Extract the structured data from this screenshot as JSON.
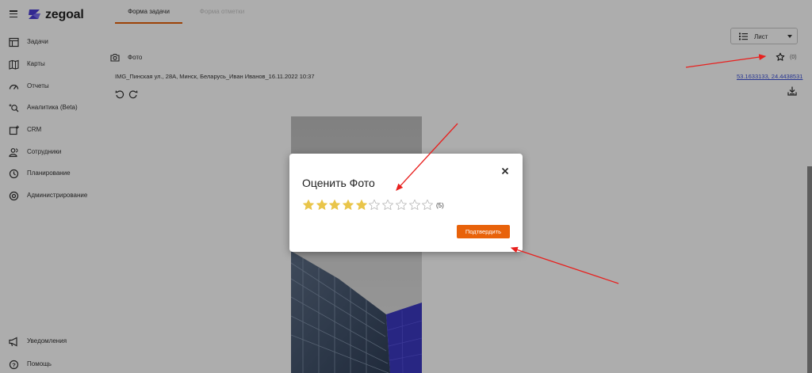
{
  "app": {
    "logo_text": "zegoal"
  },
  "sidebar": {
    "items": [
      {
        "label": "Задачи",
        "icon": "tasks-icon"
      },
      {
        "label": "Карты",
        "icon": "map-icon"
      },
      {
        "label": "Отчеты",
        "icon": "speedometer-icon"
      },
      {
        "label": "Аналитика (Beta)",
        "icon": "analytics-search-icon"
      },
      {
        "label": "CRM",
        "icon": "crm-icon"
      },
      {
        "label": "Сотрудники",
        "icon": "employees-icon"
      },
      {
        "label": "Планирование",
        "icon": "clock-icon"
      },
      {
        "label": "Администрирование",
        "icon": "settings-icon"
      }
    ],
    "bottom_items": [
      {
        "label": "Уведомления",
        "icon": "megaphone-icon"
      },
      {
        "label": "Помощь",
        "icon": "help-icon"
      }
    ]
  },
  "tabs": [
    {
      "label": "Форма задачи",
      "active": true
    },
    {
      "label": "Форма отметки",
      "active": false
    }
  ],
  "view_select": {
    "value": "Лист"
  },
  "field": {
    "label": "Фото",
    "favorite_count": "(0)",
    "filename": "IMG_Пинская ул., 28А, Минск, Беларусь_Иван Иванов_16.11.2022 10:37",
    "coordinates": "53.1633133, 24.4438531"
  },
  "modal": {
    "title": "Оценить Фото",
    "rating": 5,
    "max_rating": 10,
    "rating_count": "(5)",
    "confirm_label": "Подтвердить"
  },
  "colors": {
    "accent": "#e8620a",
    "star_filled": "#e9c54a",
    "star_empty": "#bdbdbd",
    "link": "#3a4fd6",
    "annotation_arrow": "#e8201e"
  }
}
